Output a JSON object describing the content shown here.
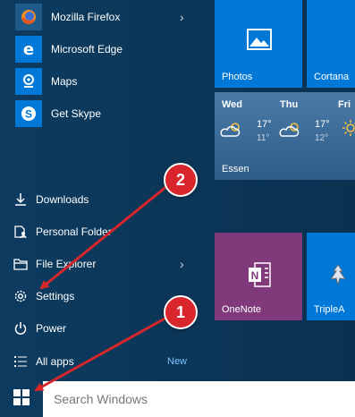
{
  "apps": [
    {
      "label": "Mozilla Firefox",
      "icon": "firefox-icon",
      "has_submenu": true
    },
    {
      "label": "Microsoft Edge",
      "icon": "edge-icon",
      "has_submenu": false
    },
    {
      "label": "Maps",
      "icon": "maps-icon",
      "has_submenu": false
    },
    {
      "label": "Get Skype",
      "icon": "skype-icon",
      "has_submenu": false
    }
  ],
  "system": [
    {
      "label": "Downloads",
      "icon": "download-icon"
    },
    {
      "label": "Personal Folder",
      "icon": "personal-folder-icon"
    },
    {
      "label": "File Explorer",
      "icon": "file-explorer-icon"
    },
    {
      "label": "Settings",
      "icon": "gear-icon"
    },
    {
      "label": "Power",
      "icon": "power-icon"
    },
    {
      "label": "All apps",
      "icon": "list-icon",
      "badge": "New"
    }
  ],
  "tiles": {
    "photos": {
      "label": "Photos",
      "color": "#0078d7"
    },
    "cortana": {
      "label": "Cortana",
      "color": "#0078d7"
    },
    "weather": {
      "location": "Essen",
      "days": [
        {
          "day": "Wed",
          "hi": "17°",
          "lo": "11°"
        },
        {
          "day": "Thu",
          "hi": "17°",
          "lo": "12°"
        },
        {
          "day": "Fri",
          "hi": "",
          "lo": ""
        }
      ]
    },
    "onenote": {
      "label": "OneNote",
      "color": "#80397b"
    },
    "triplea": {
      "label": "TripleA",
      "color": "#0078d7"
    }
  },
  "taskbar": {
    "search_placeholder": "Search Windows"
  },
  "annotations": [
    {
      "number": "1",
      "color": "#d8262c"
    },
    {
      "number": "2",
      "color": "#d8262c"
    }
  ]
}
